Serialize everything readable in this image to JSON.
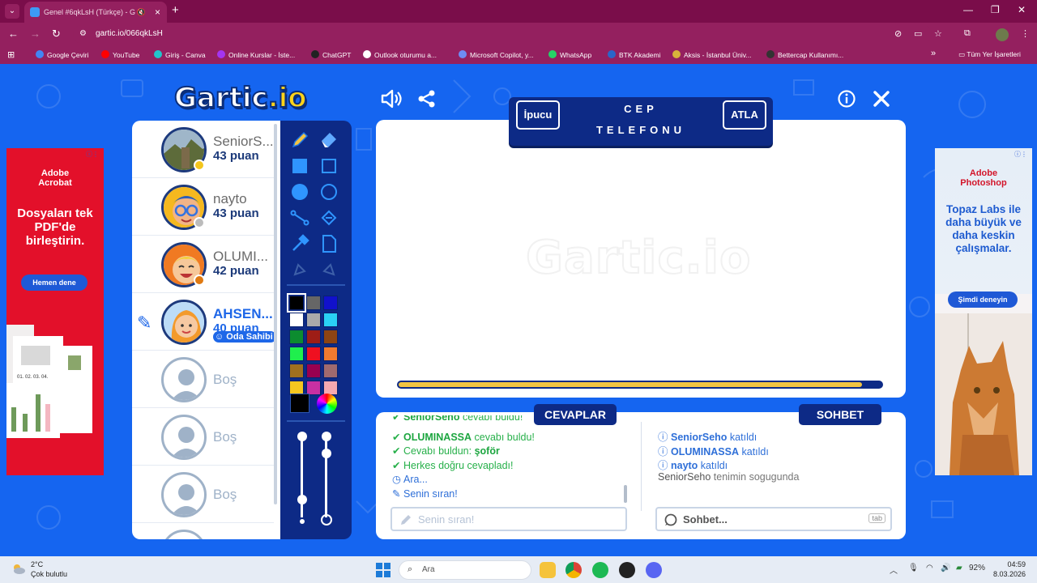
{
  "browser": {
    "tab_title": "Genel #6qkLsH (Türkçe) - G",
    "url_host": "gartic.io",
    "url_path": "/066qkLsH",
    "bookmarks": [
      {
        "label": "Google Çeviri",
        "color": "#4285f4"
      },
      {
        "label": "YouTube",
        "color": "#ff0000"
      },
      {
        "label": "Giriş - Canva",
        "color": "#20c4cb"
      },
      {
        "label": "Online Kurslar - İste...",
        "color": "#a435f0"
      },
      {
        "label": "ChatGPT",
        "color": "#222222"
      },
      {
        "label": "Outlook oturumu a...",
        "color": "#ffffff"
      },
      {
        "label": "Microsoft Copilot, y...",
        "color": "#6e8cf5"
      },
      {
        "label": "WhatsApp",
        "color": "#25d366"
      },
      {
        "label": "BTK Akademi",
        "color": "#2b65c8"
      },
      {
        "label": "Aksis - İstanbul Üniv...",
        "color": "#d8b33b"
      },
      {
        "label": "Bettercap Kullanımı...",
        "color": "#333333"
      }
    ],
    "all_bookmarks": "Tüm Yer İşaretleri"
  },
  "game": {
    "logo_main": "Gartic",
    "logo_suffix": ".io",
    "hint_button": "İpucu",
    "skip_button": "ATLA",
    "word_line1": "CEP",
    "word_line2": "TELEFONU",
    "timer_fraction": 0.96,
    "players": [
      {
        "name": "SeniorS...",
        "points": "43 puan",
        "status": "#f3c61d",
        "avatar": "photo"
      },
      {
        "name": "nayto",
        "points": "43 puan",
        "status": "#bcbcbc",
        "avatar": "glasses"
      },
      {
        "name": "OLUMI...",
        "points": "42 puan",
        "status": "#e07a12",
        "avatar": "laugh"
      },
      {
        "name": "AHSEN...",
        "points": "40 puan",
        "status": "",
        "avatar": "girl",
        "owner": "Oda Sahibi"
      }
    ],
    "empty_label": "Boş",
    "palette": [
      "#000000",
      "#666666",
      "#1111cc",
      "#ffffff",
      "#aaaaaa",
      "#2ad1f5",
      "#0c8c2f",
      "#9e1d16",
      "#8e4413",
      "#1fef4d",
      "#ef1020",
      "#f07a30",
      "#a0701f",
      "#990050",
      "#a06a6f",
      "#f5c71f",
      "#c830a2",
      "#f5a9b0"
    ],
    "answers_title": "CEVAPLAR",
    "chat_title": "SOHBET",
    "answers": [
      {
        "type": "check",
        "bold": "SeniorSeho",
        "text": " cevabı buldu!",
        "color": "green"
      },
      {
        "type": "check",
        "bold": "OLUMINASSA",
        "text": " cevabı buldu!",
        "color": "green"
      },
      {
        "type": "check",
        "bold": "",
        "text": "Cevabı buldun: ",
        "tail": "şoför",
        "color": "green"
      },
      {
        "type": "check",
        "bold": "",
        "text": "Herkes doğru cevapladı!",
        "color": "green"
      },
      {
        "type": "clock",
        "bold": "",
        "text": "Ara...",
        "color": "blue"
      },
      {
        "type": "pencil",
        "bold": "",
        "text": "Senin sıran!",
        "color": "blue"
      }
    ],
    "answer_placeholder": "Senin sıran!",
    "chat": [
      {
        "bold": "SeniorSeho",
        "text": " katıldı",
        "info": true
      },
      {
        "bold": "OLUMINASSA",
        "text": " katıldı",
        "info": true
      },
      {
        "bold": "nayto",
        "text": " katıldı",
        "info": true
      },
      {
        "bold": "SeniorSeho",
        "text": " tenimin sogugunda",
        "info": false
      }
    ],
    "chat_placeholder": "Sohbet...",
    "chat_tab_hint": "tab"
  },
  "ads": {
    "left": {
      "brand": "Adobe\nAcrobat",
      "headline": "Dosyaları tek PDF'de birleştirin.",
      "cta": "Hemen dene",
      "steps": "01. 02. 03. 04."
    },
    "right": {
      "brand": "Adobe\nPhotoshop",
      "headline": "Topaz Labs ile daha büyük ve daha keskin çalışmalar.",
      "cta": "Şimdi deneyin"
    }
  },
  "taskbar": {
    "temperature": "2°C",
    "condition": "Çok bulutlu",
    "search": "Ara",
    "battery": "92%",
    "time": "04:59",
    "date": "8.03.2026"
  }
}
